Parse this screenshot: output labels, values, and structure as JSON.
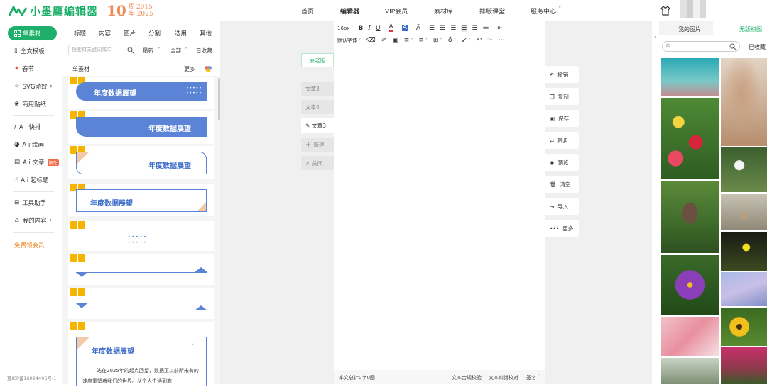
{
  "header": {
    "logo_text": "小墨鹰编辑器",
    "anniversary": {
      "number": "10",
      "unit": "周",
      "years": [
        "2015",
        "年 2025"
      ]
    },
    "nav": [
      "首页",
      "编辑器",
      "VIP会员",
      "素材库",
      "排版课堂",
      "服务中心"
    ],
    "service_arrow": "˅"
  },
  "sidebar": {
    "active": "单素材",
    "items": [
      "全文模板",
      "春节",
      "SVG动效",
      "商用贴纸",
      "A i 快排",
      "A i 绘画",
      "A i 文章",
      "A i 起标题",
      "工具助手",
      "我的内容"
    ],
    "svg_arrow": "›",
    "content_arrow": "›",
    "ai_article_badge": "限免",
    "free_vip": "免费领会员",
    "icp": "豫ICP备16024496号-1"
  },
  "material_panel": {
    "tabs": [
      "标题",
      "内容",
      "图片",
      "分割",
      "选用",
      "其他"
    ],
    "search_placeholder": "搜素材关键词或ID",
    "filters": [
      "最新",
      "全部",
      "已收藏"
    ],
    "section_title": "单素材",
    "more_label": "更多",
    "card_title": "年度数据展望",
    "card_body": "站在2025年的起点回望，数据正以前所未有的速度重塑着我们的世界。从个人生活到商"
  },
  "middle": {
    "old_version": "去老版",
    "docs": [
      "文章3",
      "文章4",
      "文章3"
    ],
    "new_label": "新建",
    "close_label": "关闭"
  },
  "editor": {
    "font_size": "16px",
    "default_font": "默认字体",
    "status_left": "本文总计0字0图",
    "status_right": [
      "文本合规校验",
      "文本纠错校对",
      "签名"
    ]
  },
  "actions": [
    "撤销",
    "复制",
    "保存",
    "同步",
    "预览",
    "清空",
    "导入",
    "更多"
  ],
  "images_panel": {
    "tabs": [
      "我的图片",
      "无版权图"
    ],
    "collected": "已收藏"
  },
  "colors": {
    "brand": "#1eb06a",
    "card_blue": "#5b84d6",
    "title_blue": "#3a6bc9",
    "peach": "#f3c9a6",
    "badge": "#f06a4a"
  }
}
